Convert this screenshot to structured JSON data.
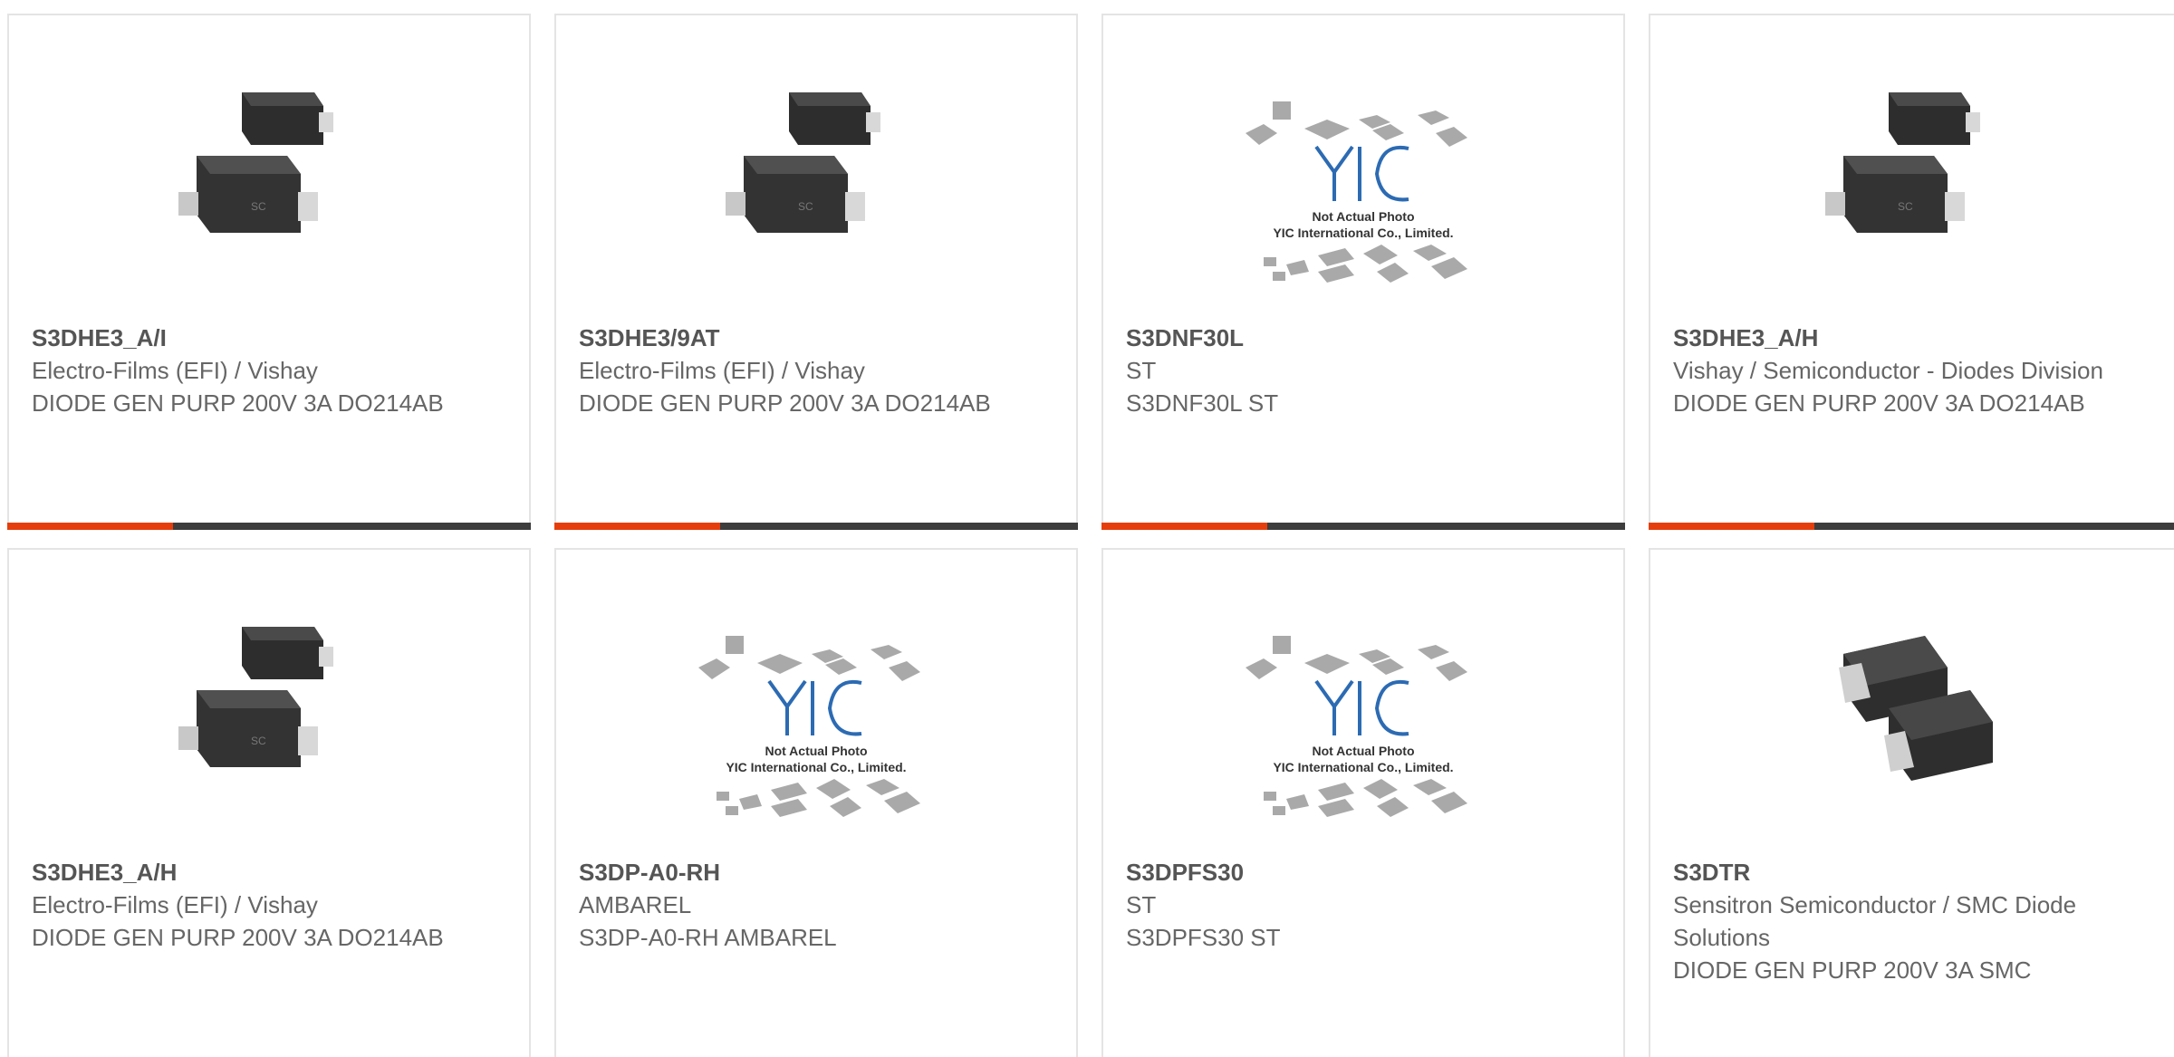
{
  "colors": {
    "accent": "#e53e0c",
    "bar": "#3d3d3d",
    "text": "#666666",
    "card_border": "#e4e4e4"
  },
  "products": [
    {
      "part_number": "S3DHE3_A/I",
      "manufacturer": "Electro-Films (EFI) / Vishay",
      "description": "DIODE GEN PURP 200V 3A DO214AB",
      "image": "smc-diode-pair-icon",
      "image_caption": ""
    },
    {
      "part_number": "S3DHE3/9AT",
      "manufacturer": "Electro-Films (EFI) / Vishay",
      "description": "DIODE GEN PURP 200V 3A DO214AB",
      "image": "smc-diode-pair-icon",
      "image_caption": ""
    },
    {
      "part_number": "S3DNF30L",
      "manufacturer": "ST",
      "description": "S3DNF30L ST",
      "image": "yic-placeholder-icon",
      "image_caption": "Not Actual Photo",
      "image_caption2": "YIC International Co., Limited."
    },
    {
      "part_number": "S3DHE3_A/H",
      "manufacturer": "Vishay / Semiconductor - Diodes Division",
      "description": "DIODE GEN PURP 200V 3A DO214AB",
      "image": "smc-diode-pair-icon",
      "image_caption": ""
    },
    {
      "part_number": "S3DHE3_A/H",
      "manufacturer": "Electro-Films (EFI) / Vishay",
      "description": "DIODE GEN PURP 200V 3A DO214AB",
      "image": "smc-diode-pair-icon",
      "image_caption": ""
    },
    {
      "part_number": "S3DP-A0-RH",
      "manufacturer": "AMBAREL",
      "description": "S3DP-A0-RH AMBAREL",
      "image": "yic-placeholder-icon",
      "image_caption": "Not Actual Photo",
      "image_caption2": "YIC International Co., Limited."
    },
    {
      "part_number": "S3DPFS30",
      "manufacturer": "ST",
      "description": "S3DPFS30 ST",
      "image": "yic-placeholder-icon",
      "image_caption": "Not Actual Photo",
      "image_caption2": "YIC International Co., Limited."
    },
    {
      "part_number": "S3DTR",
      "manufacturer": "Sensitron Semiconductor / SMC Diode Solutions",
      "description": "DIODE GEN PURP 200V 3A SMC",
      "image": "smc-diode-angled-icon",
      "image_caption": ""
    }
  ]
}
